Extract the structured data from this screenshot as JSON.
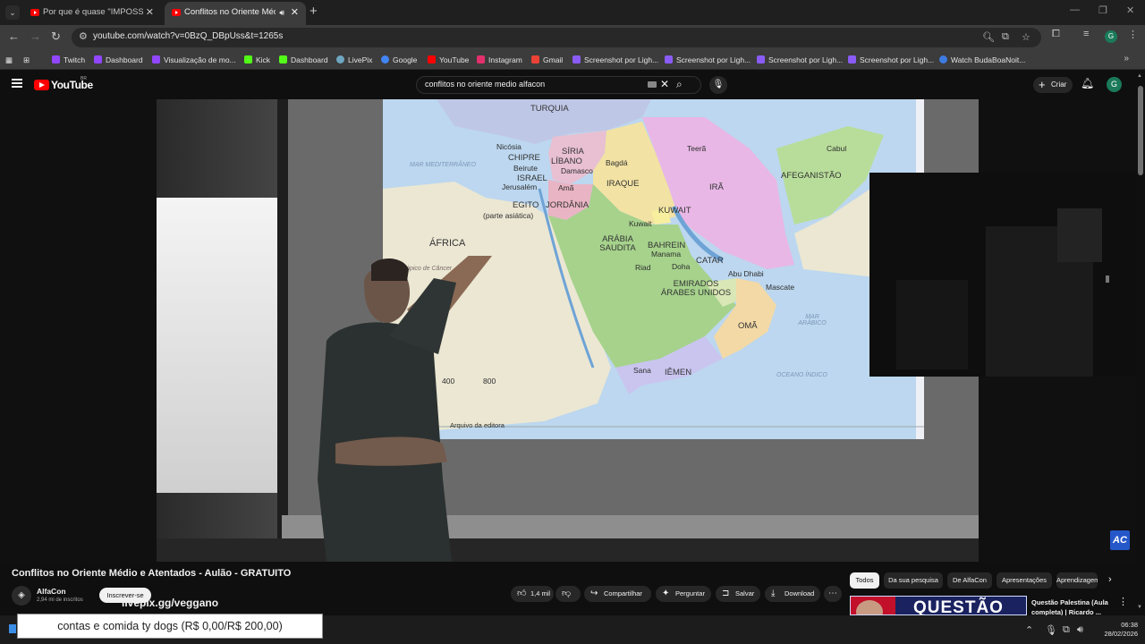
{
  "browser": {
    "tabs": [
      {
        "title": "Por que é quase \"IMPOSSÍVEL\"",
        "active": false
      },
      {
        "title": "Conflitos no Oriente Médio",
        "active": true
      }
    ],
    "url": "youtube.com/watch?v=0BzQ_DBpUss&t=1265s",
    "profile_initial": "G",
    "bookmarks": [
      {
        "label": "Twitch",
        "color": "#9146ff"
      },
      {
        "label": "Dashboard",
        "color": "#9146ff"
      },
      {
        "label": "Visualização de mo...",
        "color": "#9146ff"
      },
      {
        "label": "Kick",
        "color": "#53fc18"
      },
      {
        "label": "Dashboard",
        "color": "#53fc18"
      },
      {
        "label": "LivePix",
        "color": "#6fa7c2"
      },
      {
        "label": "Google",
        "color": "#4285f4"
      },
      {
        "label": "YouTube",
        "color": "#ff0000"
      },
      {
        "label": "Instagram",
        "color": "#e1306c"
      },
      {
        "label": "Gmail",
        "color": "#ea4335"
      },
      {
        "label": "Screenshot por Ligh...",
        "color": "#8a5cf5"
      },
      {
        "label": "Screenshot por Ligh...",
        "color": "#8a5cf5"
      },
      {
        "label": "Screenshot por Ligh...",
        "color": "#8a5cf5"
      },
      {
        "label": "Screenshot por Ligh...",
        "color": "#8a5cf5"
      },
      {
        "label": "Watch BudaBoaNoit...",
        "color": "#3d7be0"
      }
    ]
  },
  "youtube": {
    "logo": "YouTube",
    "region": "BR",
    "search_query": "conflitos no oriente medio alfacon",
    "create_label": "Criar",
    "avatar_initial": "G"
  },
  "map": {
    "countries": [
      "TURQUIA",
      "SÍRIA",
      "LÍBANO",
      "IRAQUE",
      "IRÃ",
      "AFEGANISTÃO",
      "ÁFRICA",
      "EGITO",
      "(parte asiática)",
      "ISRAEL",
      "JORDÂNIA",
      "KUWAIT",
      "ARÁBIA SAUDITA",
      "BAHREIN",
      "CATAR",
      "EMIRADOS ÁRABES UNIDOS",
      "OMÃ",
      "IÊMEN",
      "CHIPRE"
    ],
    "cities": [
      "Nicósia",
      "Beirute",
      "Damasco",
      "Bagdá",
      "Jerusalém",
      "Amã",
      "Teerã",
      "Cabul",
      "Kuwait",
      "Manama",
      "Riad",
      "Doha",
      "Abu Dhabi",
      "Mascate",
      "Sana"
    ],
    "seas": [
      "MAR MEDITERRÂNEO",
      "MAR ARÁBICO",
      "OCEANO ÍNDICO",
      "Trópico de Câncer"
    ],
    "scale": [
      "400",
      "800"
    ],
    "credit": "Arquivo da editora"
  },
  "video": {
    "title": "Conflitos no Oriente Médio e Atentados - Aulão - GRATUITO",
    "channel": "AlfaCon",
    "subscribers": "2,94 mi de inscritos",
    "subscribe_label": "Inscrever-se",
    "likes": "1,4 mil",
    "actions": [
      "Compartilhar",
      "Perguntar",
      "Salvar",
      "Download"
    ],
    "watermark": "AC"
  },
  "overlay": {
    "livepix": "livepix.gg/veggano",
    "donation": "contas e comida ty dogs (R$ 0,00/R$ 200,00)"
  },
  "chips": [
    "Todos",
    "Da sua pesquisa",
    "De AlfaCon",
    "Apresentações",
    "Aprendizagem"
  ],
  "recommended": {
    "title": "Questão Palestina (Aula completa) | Ricardo ...",
    "thumb_text": "QUESTÃO"
  },
  "taskbar": {
    "time": "06:38",
    "date": "28/02/2026"
  }
}
